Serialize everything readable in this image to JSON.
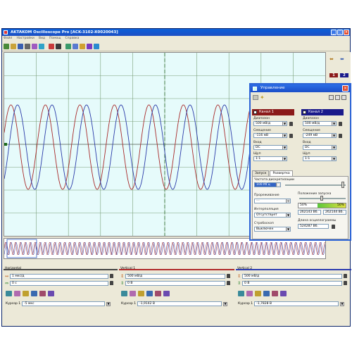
{
  "window": {
    "title": "AKTAKOM Oscilloscope Pro [ACK-3102-X0020043]",
    "menu": [
      "Файл",
      "Настройки",
      "Вид",
      "Помощ",
      "Справка"
    ]
  },
  "toolbar": {
    "icons": [
      "new-icon",
      "open-icon",
      "save-icon",
      "print-icon",
      "zoom-icon",
      "cursor-icon",
      "run-icon",
      "stop-icon",
      "measure-icon",
      "fft-icon",
      "channel-icon",
      "settings-icon",
      "help-icon"
    ]
  },
  "scope": {
    "channel_colors": {
      "ch1": "#a82a2a",
      "ch2": "#2a3aa8"
    },
    "grid_divisions": [
      10,
      8
    ],
    "marker_colors": {
      "ch1_chip": "#8b1a1a",
      "ch2_chip": "#1a1a8b"
    },
    "chip_labels": {
      "ch1": "1",
      "ch2": "2"
    }
  },
  "bottom": {
    "horizontal": {
      "header": "Horizontal",
      "timebase": "1 мкс/д",
      "offset": "0 с",
      "cursor_label": "Курсор 1",
      "cursor_value": "-5 мкс"
    },
    "vertical1": {
      "header": "Vertical 1",
      "volts": "500 мВ/д",
      "offset": "0 В",
      "cursor_label": "Курсор 1",
      "cursor_value": "-1,9142 В"
    },
    "vertical2": {
      "header": "Vertical 2",
      "volts": "500 мВ/д",
      "offset": "0 В",
      "cursor_label": "Курсор 1",
      "cursor_value": "-1,7828 В"
    }
  },
  "dialog": {
    "title": "Управление",
    "ch1": {
      "title": "Канал 1",
      "range_label": "Диапазон",
      "range": "500 мВ/д",
      "offset_label": "Смещение",
      "offset": "-116 мВ",
      "input_label": "Вход",
      "input": "DC",
      "probe_label": "Щуп",
      "probe": "1:1"
    },
    "ch2": {
      "title": "Канал 2",
      "range_label": "Диапазон",
      "range": "500 мВ/д",
      "offset_label": "Смещение",
      "offset": "-249 мВ",
      "input_label": "Вход",
      "input": "DC",
      "probe_label": "Щуп",
      "probe": "1:1"
    },
    "tabs": [
      "Запуск",
      "Развертка"
    ],
    "sample_rate_label": "Частота дискретизации",
    "sample_rate": "100 МГц",
    "thinning_label": "Прореживание",
    "thinning": "---",
    "interp_label": "Интерполяция",
    "interp": "Отсутствует",
    "stroboscope_label": "Стробоскоп",
    "stroboscope": "Выключен",
    "trig_pos_label": "Положение запуска",
    "trig_pos_left": "50%",
    "trig_pos_right": "50%",
    "trig_samples_left": "262143 Вб.",
    "trig_samples_right": "262144 Вб.",
    "record_len_label": "Длина осциллограммы",
    "record_len": "524287 Вб."
  }
}
